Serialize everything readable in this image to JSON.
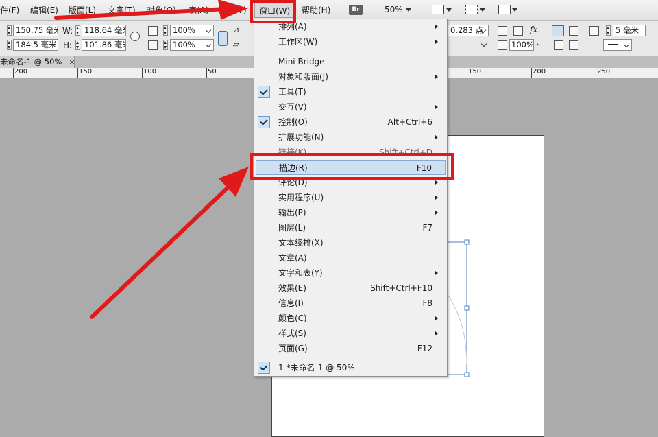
{
  "menubar": {
    "items": [
      "件(F)",
      "编辑(E)",
      "版面(L)",
      "文字(T)",
      "对象(O)",
      "表(A)",
      "视图(V)",
      "窗口(W)",
      "帮助(H)"
    ],
    "bridge_badge": "Br",
    "zoom": "50%"
  },
  "control": {
    "x_value": "150.75 毫米",
    "y_value": "184.5 毫米",
    "w_label": "W:",
    "w_value": "118.64 毫米",
    "h_label": "H:",
    "h_value": "101.86 毫米",
    "scale_x": "100%",
    "scale_y": "100%",
    "stroke_weight": "0.283 点",
    "opacity": "100%",
    "fx_label": "fx.",
    "corner_value": "5 毫米"
  },
  "document": {
    "tab_title": "未命名-1 @ 50%",
    "tab_close": "×"
  },
  "ruler": {
    "labels": [
      "200",
      "150",
      "100",
      "50",
      "150",
      "200",
      "250"
    ]
  },
  "window_menu": {
    "items": [
      {
        "label": "排列(A)",
        "shortcut": "",
        "submenu": true,
        "checked": false
      },
      {
        "label": "工作区(W)",
        "shortcut": "",
        "submenu": true,
        "checked": false
      },
      {
        "label": "Mini Bridge",
        "shortcut": "",
        "submenu": false,
        "checked": false
      },
      {
        "label": "对象和版面(J)",
        "shortcut": "",
        "submenu": true,
        "checked": false
      },
      {
        "label": "工具(T)",
        "shortcut": "",
        "submenu": false,
        "checked": true
      },
      {
        "label": "交互(V)",
        "shortcut": "",
        "submenu": true,
        "checked": false
      },
      {
        "label": "控制(O)",
        "shortcut": "Alt+Ctrl+6",
        "submenu": false,
        "checked": true
      },
      {
        "label": "扩展功能(N)",
        "shortcut": "",
        "submenu": true,
        "checked": false
      },
      {
        "label": "链接(K)",
        "shortcut": "Shift+Ctrl+D",
        "submenu": false,
        "checked": false
      },
      {
        "label": "描边(R)",
        "shortcut": "F10",
        "submenu": false,
        "checked": false
      },
      {
        "label": "评论(D)",
        "shortcut": "",
        "submenu": true,
        "checked": false
      },
      {
        "label": "实用程序(U)",
        "shortcut": "",
        "submenu": true,
        "checked": false
      },
      {
        "label": "输出(P)",
        "shortcut": "",
        "submenu": true,
        "checked": false
      },
      {
        "label": "图层(L)",
        "shortcut": "F7",
        "submenu": false,
        "checked": false
      },
      {
        "label": "文本绕排(X)",
        "shortcut": "",
        "submenu": false,
        "checked": false
      },
      {
        "label": "文章(A)",
        "shortcut": "",
        "submenu": false,
        "checked": false
      },
      {
        "label": "文字和表(Y)",
        "shortcut": "",
        "submenu": true,
        "checked": false
      },
      {
        "label": "效果(E)",
        "shortcut": "Shift+Ctrl+F10",
        "submenu": false,
        "checked": false
      },
      {
        "label": "信息(I)",
        "shortcut": "F8",
        "submenu": false,
        "checked": false
      },
      {
        "label": "颜色(C)",
        "shortcut": "",
        "submenu": true,
        "checked": false
      },
      {
        "label": "样式(S)",
        "shortcut": "",
        "submenu": true,
        "checked": false
      },
      {
        "label": "页面(G)",
        "shortcut": "F12",
        "submenu": false,
        "checked": false
      },
      {
        "label": "1 *未命名-1 @ 50%",
        "shortcut": "",
        "submenu": false,
        "checked": true
      }
    ]
  },
  "colors": {
    "annotation": "#e01a1a",
    "highlight": "#cfe0f3",
    "selection_frame": "#4a7fc1"
  }
}
